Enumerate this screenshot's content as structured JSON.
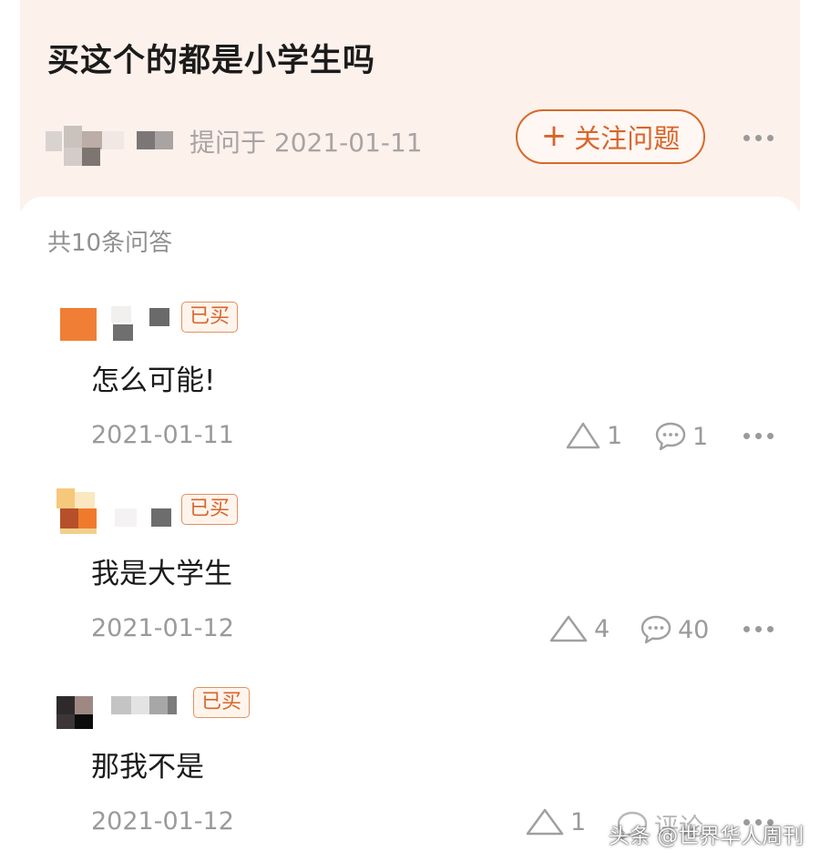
{
  "question": {
    "title": "买这个的都是小学生吗",
    "ask_time": "提问于 2021-01-11",
    "follow_label": "关注问题",
    "follow_plus": "+"
  },
  "answers_count_label": "共10条问答",
  "answers": [
    {
      "badge": "已买",
      "text": "怎么可能!",
      "date": "2021-01-11",
      "like_count": "1",
      "comment_count": "1"
    },
    {
      "badge": "已买",
      "text": "我是大学生",
      "date": "2021-01-12",
      "like_count": "4",
      "comment_count": "40"
    },
    {
      "badge": "已买",
      "text": "那我不是",
      "date": "2021-01-12",
      "like_count": "1",
      "comment_label": "评论"
    }
  ],
  "watermark": "头条 @世界华人周刊",
  "icons": {
    "like": "triangle-like-icon",
    "comment": "speech-bubble-icon",
    "more": "ellipsis-icon",
    "follow": "plus-icon"
  },
  "colors": {
    "accent": "#d8652a",
    "header_bg": "#fdf1ec",
    "muted_text": "#9a9a9a"
  }
}
